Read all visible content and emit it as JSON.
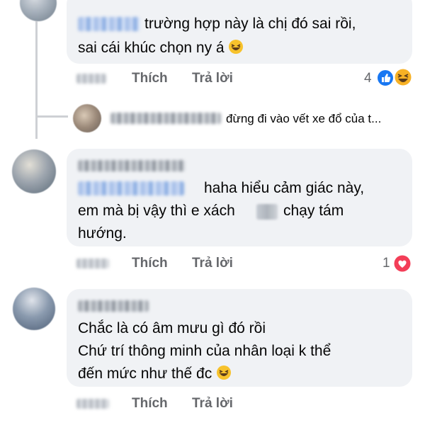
{
  "comments": [
    {
      "text_line1": "trường hợp này là chị đó sai rồi,",
      "text_line2": "sai cái khúc chọn ny á",
      "emoji": "laughing-emoji",
      "like_label": "Thích",
      "reply_label": "Trả lời",
      "reaction_count": "4",
      "reactions": [
        "like",
        "haha"
      ]
    },
    {
      "reply_preview": "đừng đi vào vết xe đổ của t..."
    },
    {
      "text_line1": "haha hiểu cảm giác này,",
      "text_line2a": "em mà bị vậy thì e xách",
      "text_line2b": "chạy tám",
      "text_line3": "hướng.",
      "like_label": "Thích",
      "reply_label": "Trả lời",
      "reaction_count": "1",
      "reactions": [
        "love"
      ]
    },
    {
      "text_line1": "Chắc là có âm mưu gì đó rồi",
      "text_line2": "Chứ trí thông minh của nhân loại k thể",
      "text_line3": "đến mức như thế đc",
      "emoji": "laughing-emoji",
      "like_label": "Thích",
      "reply_label": "Trả lời"
    }
  ],
  "colors": {
    "bubble": "#f0f2f5",
    "action_text": "#65676b",
    "like_blue": "#1877f2",
    "love_red": "#f33e58",
    "haha_yellow": "#f7b125"
  }
}
